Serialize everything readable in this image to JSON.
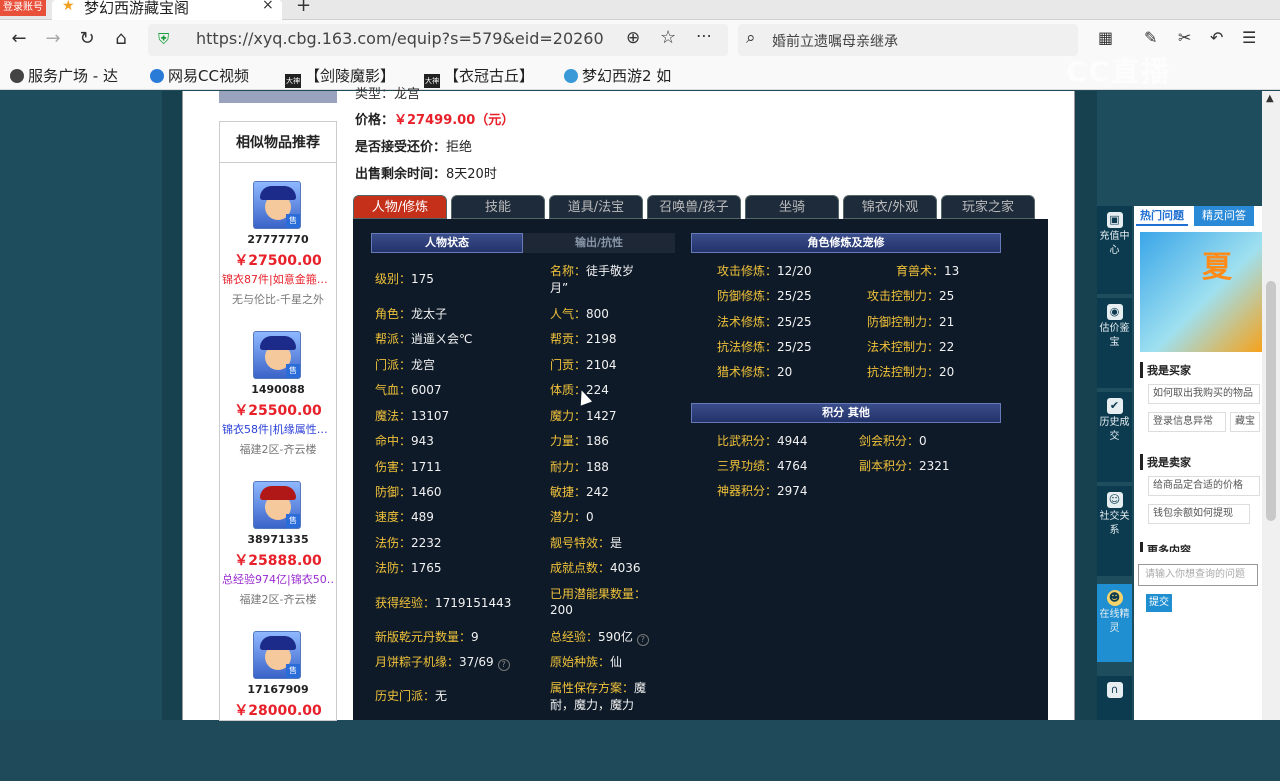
{
  "browser": {
    "live_badge": "登录账号",
    "tab_title": "梦幻西游藏宝阁",
    "tab_close": "×",
    "new_tab": "+",
    "url": "https://xyq.cbg.163.com/equip?s=579&eid=20260",
    "search_text": "婚前立遗嘱母亲继承",
    "bookmarks": [
      "服务广场 - 达",
      "网易CC视频",
      "【剑陵魔影】",
      "【衣冠古丘】",
      "梦幻西游2 如"
    ],
    "bookmark_tag": "大神"
  },
  "watermark": "CC直播",
  "item_info": {
    "type_label": "类型：",
    "type_value": "龙宫",
    "price_label": "价格：",
    "price_value": "￥27499.00（元）",
    "bargain_label": "是否接受还价：",
    "bargain_value": "拒绝",
    "remain_label": "出售剩余时间：",
    "remain_value": "8天20时"
  },
  "similar": {
    "title": "相似物品推荐",
    "tag": "售",
    "items": [
      {
        "id": "27777770",
        "price": "￥27500.00",
        "desc": "锦衣87件|如意金箍…",
        "desc_color": "#e8202a",
        "server": "无与伦比-千星之外"
      },
      {
        "id": "1490088",
        "price": "￥25500.00",
        "desc": "锦衣58件|机缘属性…",
        "desc_color": "#2a3fd8",
        "server": "福建2区-齐云楼"
      },
      {
        "id": "38971335",
        "price": "￥25888.00",
        "desc": "总经验974亿|锦衣50…",
        "desc_color": "#9a2ad0",
        "server": "福建2区-齐云楼"
      },
      {
        "id": "17167909",
        "price": "￥28000.00",
        "desc": "",
        "desc_color": "#222",
        "server": ""
      }
    ]
  },
  "tabs": [
    "人物/修炼",
    "技能",
    "道具/法宝",
    "召唤兽/孩子",
    "坐骑",
    "锦衣/外观",
    "玩家之家"
  ],
  "panel": {
    "status_tab_active": "人物状态",
    "status_tab_inactive": "输出/抗性",
    "cultivation_header": "角色修炼及宠修",
    "points_header": "积分  其他",
    "left_col": [
      {
        "label": "级别：",
        "value": "175"
      },
      {
        "label": "角色：",
        "value": "龙太子"
      },
      {
        "label": "帮派：",
        "value": "逍遥ㄨ会℃"
      },
      {
        "label": "门派：",
        "value": "龙宫"
      },
      {
        "label": "气血：",
        "value": "6007"
      },
      {
        "label": "魔法：",
        "value": "13107"
      },
      {
        "label": "命中：",
        "value": "943"
      },
      {
        "label": "伤害：",
        "value": "1711"
      },
      {
        "label": "防御：",
        "value": "1460"
      },
      {
        "label": "速度：",
        "value": "489"
      },
      {
        "label": "法伤：",
        "value": "2232"
      },
      {
        "label": "法防：",
        "value": "1765"
      },
      {
        "label": "获得经验：",
        "value": "1719151443"
      },
      {
        "label": "新版乾元丹数量：",
        "value": "9"
      },
      {
        "label": "月饼粽子机缘：",
        "value": "37/69"
      },
      {
        "label": "历史门派：",
        "value": "无"
      }
    ],
    "name_label": "名称：",
    "name_value": "徒手敬岁",
    "name_value2": "月”",
    "mid_col": [
      {
        "label": "人气：",
        "value": "800"
      },
      {
        "label": "帮贡：",
        "value": "2198"
      },
      {
        "label": "门贡：",
        "value": "2104"
      },
      {
        "label": "体质：",
        "value": "224"
      },
      {
        "label": "魔力：",
        "value": "1427"
      },
      {
        "label": "力量：",
        "value": "186"
      },
      {
        "label": "耐力：",
        "value": "188"
      },
      {
        "label": "敏捷：",
        "value": "242"
      },
      {
        "label": "潜力：",
        "value": "0"
      },
      {
        "label": "靓号特效：",
        "value": "是"
      },
      {
        "label": "成就点数：",
        "value": "4036"
      }
    ],
    "potential_label": "已用潜能果数量：",
    "potential_value": "200",
    "total_exp_label": "总经验：",
    "total_exp_value": "590亿",
    "race_label": "原始种族：",
    "race_value": "仙",
    "scheme_label": "属性保存方案：",
    "scheme_value1": "魔",
    "scheme_value2": "耐，魔力，魔力",
    "cultivation": [
      {
        "l1": "攻击修炼：",
        "v1": "12/20",
        "l2": "育兽术：",
        "v2": "13"
      },
      {
        "l1": "防御修炼：",
        "v1": "25/25",
        "l2": "攻击控制力：",
        "v2": "25"
      },
      {
        "l1": "法术修炼：",
        "v1": "25/25",
        "l2": "防御控制力：",
        "v2": "21"
      },
      {
        "l1": "抗法修炼：",
        "v1": "25/25",
        "l2": "法术控制力：",
        "v2": "22"
      },
      {
        "l1": "猎术修炼：",
        "v1": "20",
        "l2": "抗法控制力：",
        "v2": "20"
      }
    ],
    "points": [
      {
        "l1": "比武积分：",
        "v1": "4944",
        "l2": "剑会积分：",
        "v2": "0"
      },
      {
        "l1": "三界功绩：",
        "v1": "4764",
        "l2": "副本积分：",
        "v2": "2321"
      },
      {
        "l1": "神器积分：",
        "v1": "2974",
        "l2": "",
        "v2": ""
      }
    ]
  },
  "sidebar": {
    "recharge": "充值中心",
    "appraise": "估价鉴宝",
    "history": "历史成交",
    "social": "社交关系",
    "online": "在线精灵"
  },
  "help": {
    "tab_hot": "热门问题",
    "tab_elf": "精灵问答",
    "banner": "夏",
    "buyer_title": "我是买家",
    "buyer_links": [
      "如何取出我购买的物品",
      "登录信息异常",
      "藏宝"
    ],
    "seller_title": "我是卖家",
    "seller_links": [
      "给商品定合适的价格",
      "钱包余额如何提现"
    ],
    "more_title": "更多内容",
    "input_placeholder": "请输入你想查询的问题",
    "submit": "提交"
  }
}
